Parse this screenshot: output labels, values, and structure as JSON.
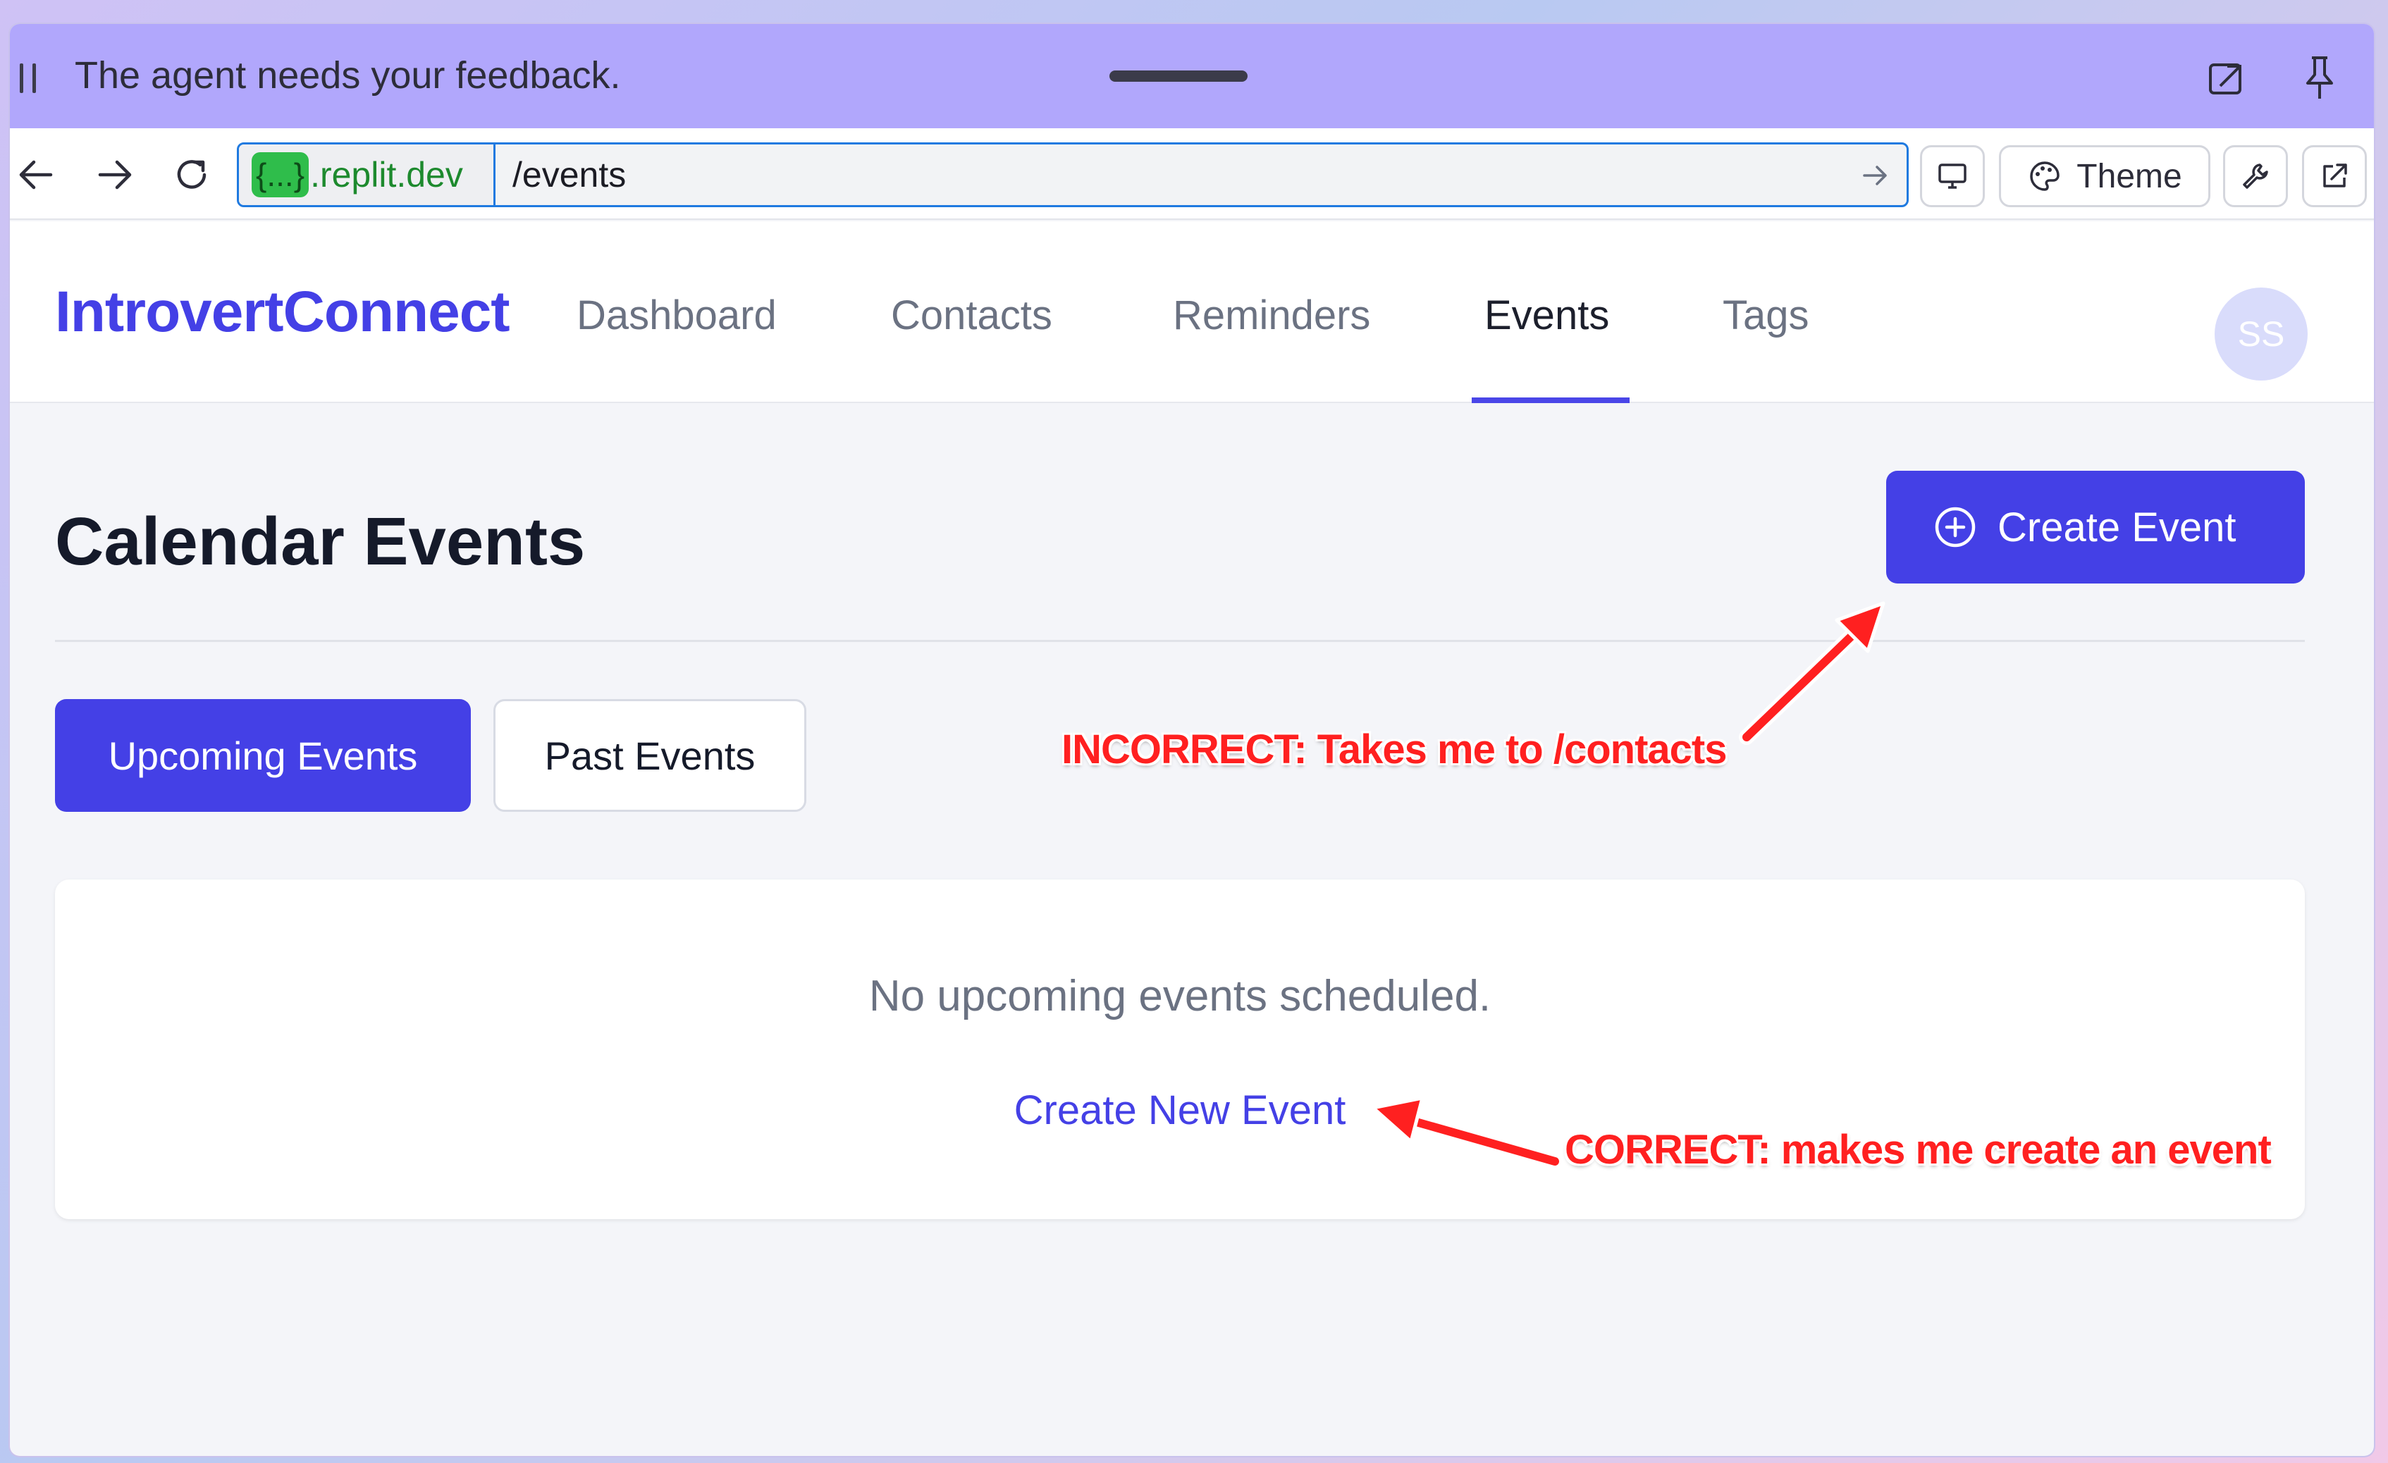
{
  "feedback_bar": {
    "message": "The agent needs your feedback."
  },
  "browser": {
    "domain_badge": "{...}",
    "domain": ".replit.dev",
    "path": "/events",
    "theme_label": "Theme"
  },
  "app": {
    "brand": "IntrovertConnect",
    "nav": [
      "Dashboard",
      "Contacts",
      "Reminders",
      "Events",
      "Tags"
    ],
    "active_nav": "Events",
    "avatar_initials": "SS"
  },
  "page": {
    "title": "Calendar Events",
    "create_button": "Create Event",
    "tabs": [
      "Upcoming Events",
      "Past Events"
    ],
    "empty_message": "No upcoming events scheduled.",
    "create_link": "Create New Event"
  },
  "annotations": {
    "incorrect": "INCORRECT: Takes me to /contacts",
    "correct": "CORRECT: makes me create an event"
  },
  "colors": {
    "accent": "#4440e6",
    "feedback_bar": "#b1a7fc",
    "annotation": "#ff2020"
  }
}
